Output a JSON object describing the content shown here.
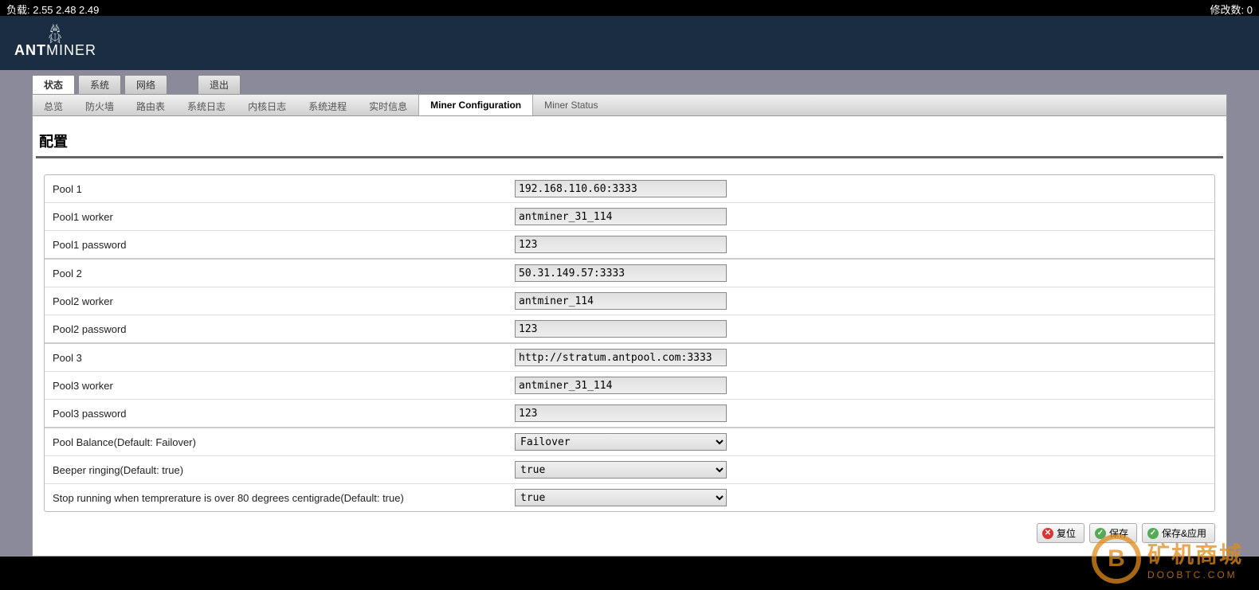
{
  "topbar": {
    "load_label": "负载: 2.55 2.48 2.49",
    "changes_label": "修改数: 0"
  },
  "logo": {
    "brand_bold": "ANT",
    "brand_thin": "MINER"
  },
  "main_tabs": {
    "status": "状态",
    "system": "系统",
    "network": "网络",
    "logout": "退出"
  },
  "sub_tabs": {
    "overview": "总览",
    "firewall": "防火墙",
    "routes": "路由表",
    "syslog": "系统日志",
    "kernlog": "内核日志",
    "processes": "系统进程",
    "realtime": "实时信息",
    "miner_conf": "Miner Configuration",
    "miner_status": "Miner Status"
  },
  "page": {
    "title": "配置"
  },
  "form": {
    "pool1_label": "Pool 1",
    "pool1_value": "192.168.110.60:3333",
    "pool1_worker_label": "Pool1 worker",
    "pool1_worker_value": "antminer_31_114",
    "pool1_pw_label": "Pool1 password",
    "pool1_pw_value": "123",
    "pool2_label": "Pool 2",
    "pool2_value": "50.31.149.57:3333",
    "pool2_worker_label": "Pool2 worker",
    "pool2_worker_value": "antminer_114",
    "pool2_pw_label": "Pool2 password",
    "pool2_pw_value": "123",
    "pool3_label": "Pool 3",
    "pool3_value": "http://stratum.antpool.com:3333",
    "pool3_worker_label": "Pool3 worker",
    "pool3_worker_value": "antminer_31_114",
    "pool3_pw_label": "Pool3 password",
    "pool3_pw_value": "123",
    "balance_label": "Pool Balance(Default: Failover)",
    "balance_value": "Failover",
    "beeper_label": "Beeper ringing(Default: true)",
    "beeper_value": "true",
    "temp_label": "Stop running when temprerature is over 80 degrees centigrade(Default: true)",
    "temp_value": "true"
  },
  "buttons": {
    "reset": "复位",
    "save": "保存",
    "save_apply": "保存&应用"
  },
  "watermark": {
    "symbol": "B",
    "cn": "矿机商城",
    "en": "DOOBTC.COM"
  }
}
